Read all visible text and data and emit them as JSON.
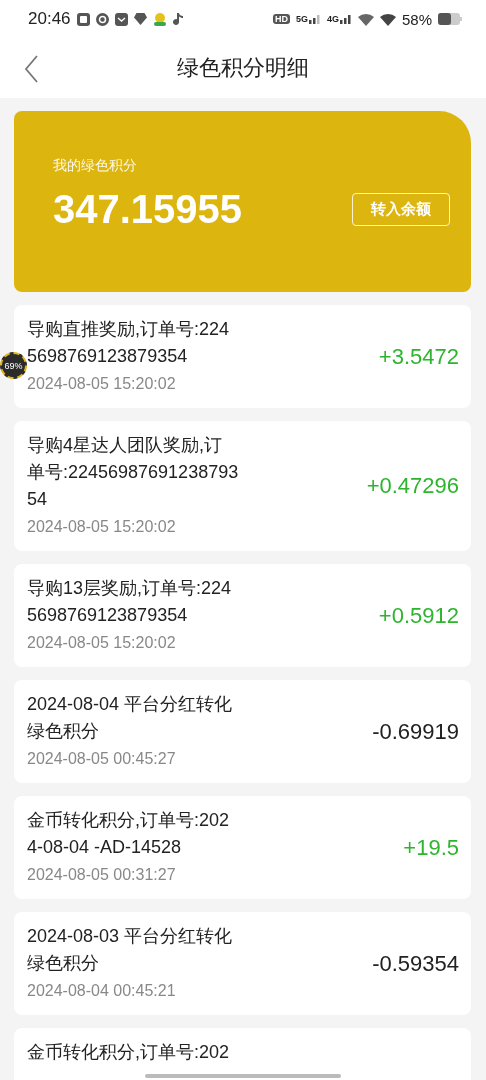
{
  "status_bar": {
    "time": "20:46",
    "network": [
      "HD",
      "5G",
      "4G"
    ],
    "battery": "58%"
  },
  "header": {
    "title": "绿色积分明细"
  },
  "summary": {
    "label": "我的绿色积分",
    "value": "347.15955",
    "button": "转入余额"
  },
  "records": [
    {
      "title": "导购直推奖励,订单号:2245698769123879354",
      "time": "2024-08-05 15:20:02",
      "amount": "+3.5472",
      "kind": "income"
    },
    {
      "title": "导购4星达人团队奖励,订单号:2245698769123879354",
      "time": "2024-08-05 15:20:02",
      "amount": "+0.47296",
      "kind": "income"
    },
    {
      "title": "导购13层奖励,订单号:2245698769123879354",
      "time": "2024-08-05 15:20:02",
      "amount": "+0.5912",
      "kind": "income"
    },
    {
      "title": "2024-08-04 平台分红转化绿色积分",
      "time": "2024-08-05 00:45:27",
      "amount": "-0.69919",
      "kind": "expense"
    },
    {
      "title": "金币转化积分,订单号:2024-08-04 -AD-14528",
      "time": "2024-08-05 00:31:27",
      "amount": "+19.5",
      "kind": "income"
    },
    {
      "title": "2024-08-03 平台分红转化绿色积分",
      "time": "2024-08-04 00:45:21",
      "amount": "-0.59354",
      "kind": "expense"
    },
    {
      "title": "金币转化积分,订单号:202"
    }
  ],
  "float_ball": {
    "label": "69%"
  }
}
